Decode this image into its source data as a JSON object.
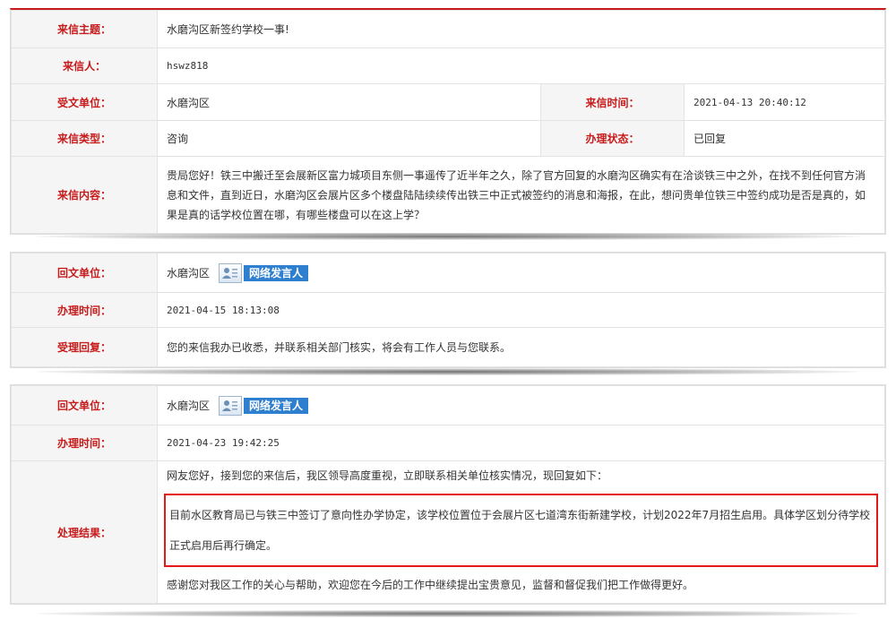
{
  "letter": {
    "subject_label": "来信主题：",
    "subject": "水磨沟区新签约学校一事!",
    "sender_label": "来信人：",
    "sender": "hswz818",
    "receiver_label": "受文单位：",
    "receiver": "水磨沟区",
    "time_label": "来信时间：",
    "time": "2021-04-13 20:40:12",
    "type_label": "来信类型：",
    "type": "咨询",
    "status_label": "办理状态：",
    "status": "已回复",
    "content_label": "来信内容：",
    "content": "贵局您好！铁三中搬迁至会展新区富力城项目东侧一事遥传了近半年之久，除了官方回复的水磨沟区确实有在洽谈铁三中之外，在找不到任何官方消息和文件，直到近日，水磨沟区会展片区多个楼盘陆陆续续传出铁三中正式被签约的消息和海报，在此，想问贵单位铁三中签约成功是否是真的，如果是真的话学校位置在哪，有哪些楼盘可以在这上学？"
  },
  "reply1": {
    "org_label": "回文单位：",
    "org": "水磨沟区",
    "badge": "网络发言人",
    "time_label": "办理时间：",
    "time": "2021-04-15 18:13:08",
    "reply_label": "受理回复：",
    "reply": "您的来信我办已收悉，并联系相关部门核实，将会有工作人员与您联系。"
  },
  "reply2": {
    "org_label": "回文单位：",
    "org": "水磨沟区",
    "badge": "网络发言人",
    "time_label": "办理时间：",
    "time": "2021-04-23 19:42:25",
    "result_label": "处理结果：",
    "para1": "网友您好，接到您的来信后，我区领导高度重视，立即联系相关单位核实情况，现回复如下：",
    "para2": "目前水区教育局已与铁三中签订了意向性办学协定，该学校位置位于会展片区七道湾东街新建学校，计划2022年7月招生启用。具体学区划分待学校正式启用后再行确定。",
    "para3": "感谢您对我区工作的关心与帮助，欢迎您在今后的工作中继续提出宝贵意见，监督和督促我们把工作做得更好。"
  },
  "colors": {
    "label": "#c81a1a",
    "badge": "#2f7fd0",
    "highlight": "#e31919"
  }
}
